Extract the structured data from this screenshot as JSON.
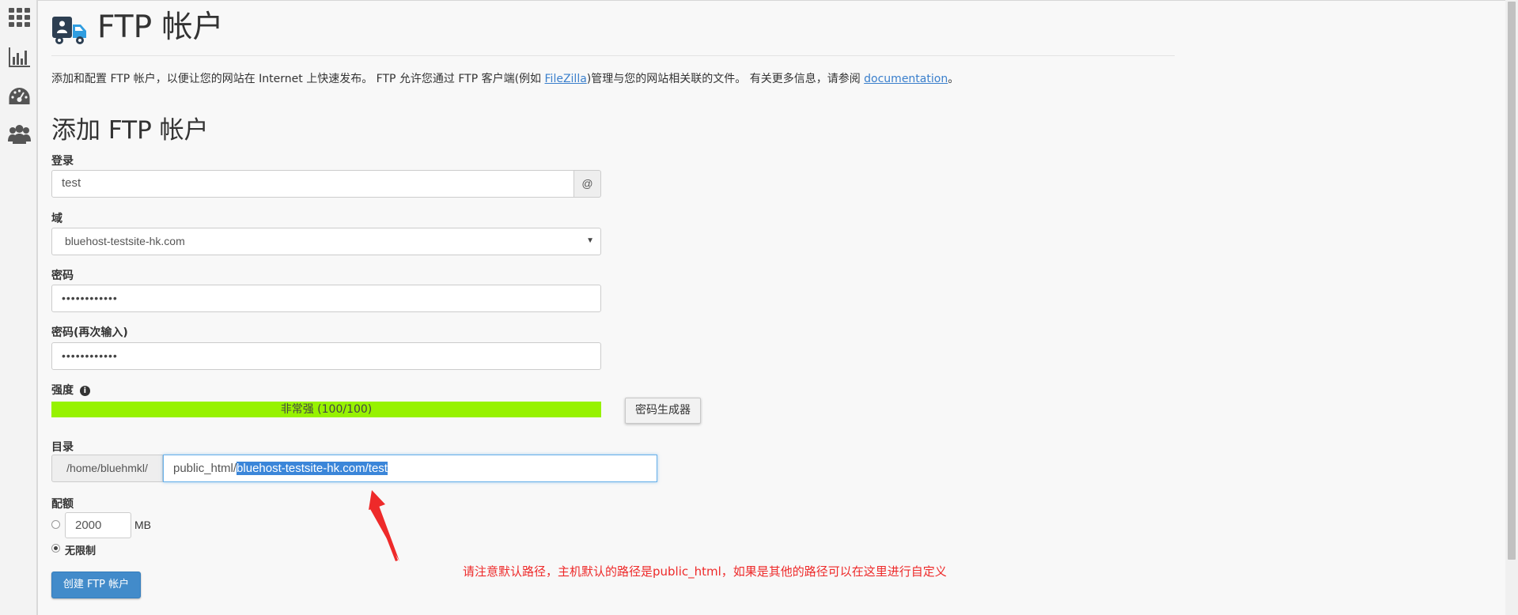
{
  "sidebar": {
    "items": [
      {
        "icon": "grid-icon"
      },
      {
        "icon": "bar-chart-icon"
      },
      {
        "icon": "dashboard-icon"
      },
      {
        "icon": "users-icon"
      }
    ]
  },
  "header": {
    "title": "FTP 帐户",
    "icon": "ftp-truck-icon"
  },
  "intro": {
    "text_before": "添加和配置 FTP 帐户，以便让您的网站在 Internet 上快速发布。 FTP 允许您通过 FTP 客户端(例如 ",
    "filezilla_link": "FileZilla",
    "text_middle": ")管理与您的网站相关联的文件。 有关更多信息，请参阅 ",
    "documentation_link": "documentation",
    "text_after": "。"
  },
  "form": {
    "section_title": "添加 FTP 帐户",
    "login_label": "登录",
    "login_value": "test",
    "login_addon": "@",
    "domain_label": "域",
    "domain_value": "bluehost-testsite-hk.com",
    "password_label": "密码",
    "password_value": "••••••••••••",
    "password_again_label": "密码(再次输入)",
    "password_again_value": "••••••••••••",
    "strength_label": "强度",
    "strength_text": "非常强 (100/100)",
    "strength_score": 100,
    "generator_button": "密码生成器",
    "directory_label": "目录",
    "directory_prefix": "/home/bluehmkl/",
    "directory_base": "public_html/",
    "directory_selected": "bluehost-testsite-hk.com/test",
    "quota_label": "配额",
    "quota_value": "2000",
    "quota_unit": "MB",
    "unlimited_label": "无限制",
    "quota_mode": "unlimited",
    "create_button": "创建 FTP 帐户"
  },
  "annotation": {
    "text": "请注意默认路径，主机默认的路径是public_html，如果是其他的路径可以在这里进行自定义",
    "color": "#ee2a2a"
  },
  "colors": {
    "strength": "#97f200",
    "primary": "#428bca",
    "link": "#3a7fcc",
    "selection": "#3b86d9"
  }
}
